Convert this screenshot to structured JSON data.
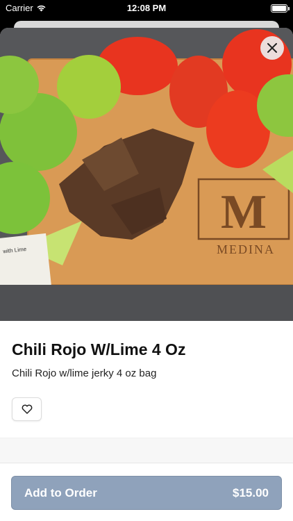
{
  "status_bar": {
    "carrier": "Carrier",
    "time": "12:08 PM"
  },
  "product": {
    "image_brand": "MEDINA",
    "image_monogram": "M",
    "title": "Chili Rojo W/Lime 4 Oz",
    "description": "Chili Rojo w/lime jerky 4 oz bag"
  },
  "icons": {
    "close": "close-icon",
    "favorite": "heart-icon",
    "wifi": "wifi-icon",
    "battery": "battery-icon"
  },
  "footer": {
    "add_label": "Add to Order",
    "price": "$15.00"
  },
  "colors": {
    "add_button": "#8fa2bb",
    "board": "#d99a55",
    "tomato": "#e8341f",
    "lime": "#8cc63f"
  }
}
